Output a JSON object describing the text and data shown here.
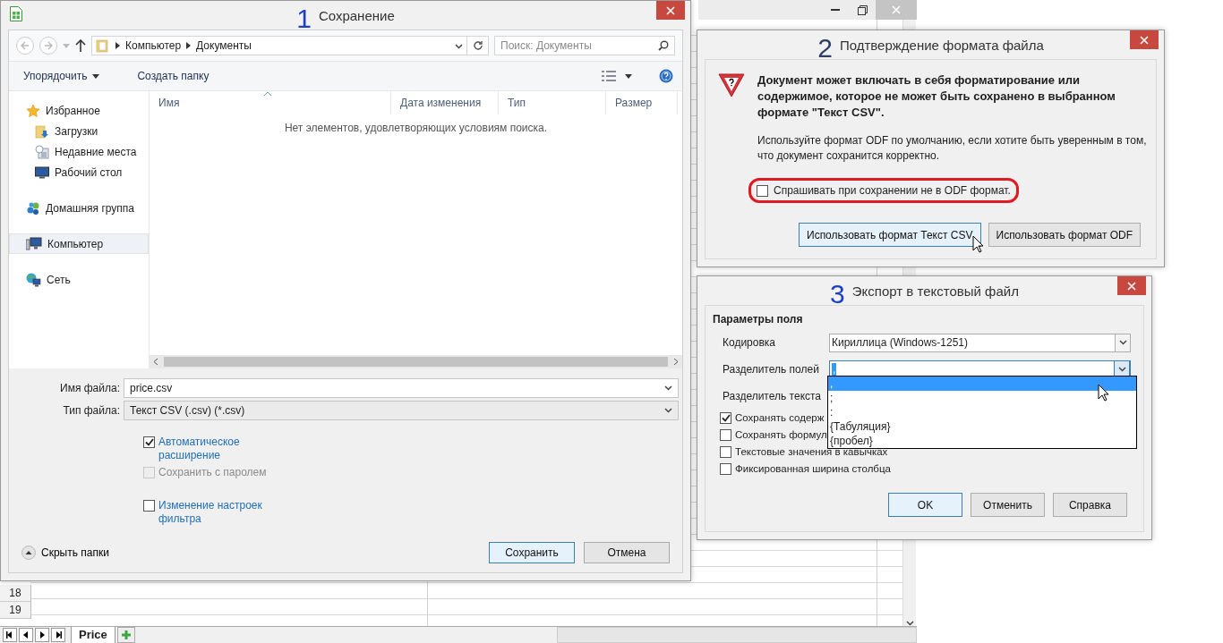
{
  "spreadsheet": {
    "row_numbers": [
      "18",
      "19"
    ],
    "sheet_tabs": [
      {
        "label": "Price",
        "selected": true
      }
    ]
  },
  "save_dialog": {
    "step": "1",
    "title": "Сохранение",
    "breadcrumb": [
      "Компьютер",
      "Документы"
    ],
    "search": {
      "placeholder": "Поиск: Документы"
    },
    "toolbar": [
      "Упорядочить",
      "Создать папку"
    ],
    "nav": [
      {
        "label": "Избранное",
        "selected": false,
        "children": [
          {
            "label": "Загрузки",
            "selected": false
          },
          {
            "label": "Недавние места",
            "selected": false
          },
          {
            "label": "Рабочий стол",
            "selected": false
          }
        ]
      },
      {
        "label": "Домашняя группа",
        "selected": false
      },
      {
        "label": "Компьютер",
        "selected": true
      },
      {
        "label": "Сеть",
        "selected": false
      }
    ],
    "columns": [
      "Имя",
      "Дата изменения",
      "Тип",
      "Размер"
    ],
    "empty_message": "Нет элементов, удовлетворяющих условиям поиска.",
    "fields": [
      {
        "label": "Имя файла:",
        "value": "price.csv"
      },
      {
        "label": "Тип файла:",
        "value": "Текст CSV (.csv) (*.csv)"
      }
    ],
    "options": [
      {
        "label": "Автоматическое расширение",
        "checked": true,
        "disabled": false
      },
      {
        "label": "Сохранить с паролем",
        "checked": false,
        "disabled": true
      },
      {
        "label": "Изменение настроек фильтра",
        "checked": false,
        "disabled": false
      }
    ],
    "hide_folders": "Скрыть папки",
    "buttons": [
      {
        "label": "Сохранить",
        "default": true
      },
      {
        "label": "Отмена",
        "default": false
      }
    ]
  },
  "format_dialog": {
    "step": "2",
    "title": "Подтверждение формата файла",
    "message": "Документ может включать в себя форматирование или содержимое, которое не может быть сохранено в выбранном формате \"Текст CSV\".",
    "note": "Используйте формат ODF по умолчанию, если хотите быть уверенным в том, что документ сохранится корректно.",
    "ask_option": {
      "label": "Спрашивать при сохранении не в ODF формат.",
      "checked": false
    },
    "buttons": [
      {
        "label": "Использовать формат Текст CSV",
        "default": true
      },
      {
        "label": "Использовать формат ODF",
        "default": false
      }
    ]
  },
  "export_dialog": {
    "step": "3",
    "title": "Экспорт в текстовый файл",
    "section": "Параметры поля",
    "fields": [
      {
        "label": "Кодировка",
        "value": "Кириллица (Windows-1251)"
      },
      {
        "label": "Разделитель полей",
        "value": ","
      },
      {
        "label": "Разделитель текста"
      }
    ],
    "separator_options": [
      {
        "label": ",",
        "selected": true
      },
      {
        "label": ";",
        "selected": false
      },
      {
        "label": ":",
        "selected": false
      },
      {
        "label": "{Табуляция}",
        "selected": false
      },
      {
        "label": "{пробел}",
        "selected": false
      }
    ],
    "options": [
      {
        "label": "Сохранять содерж",
        "checked": true
      },
      {
        "label": "Сохранять формул",
        "checked": false
      },
      {
        "label": "Текстовые значения в кавычках",
        "checked": false
      },
      {
        "label": "Фиксированная ширина столбца",
        "checked": false
      }
    ],
    "buttons": [
      {
        "label": "OK",
        "default": true
      },
      {
        "label": "Отменить",
        "default": false
      },
      {
        "label": "Справка",
        "default": false
      }
    ]
  }
}
